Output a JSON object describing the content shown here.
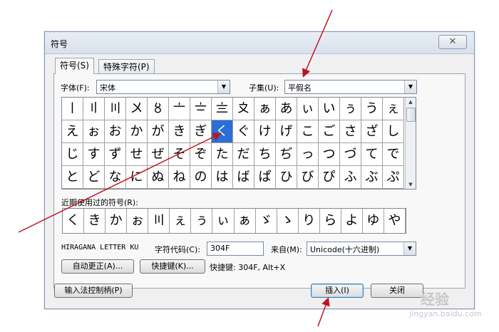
{
  "dialog": {
    "title": "符号",
    "close_glyph": "✕",
    "tabs": [
      {
        "label": "符号(S)",
        "active": true
      },
      {
        "label": "特殊字符(P)",
        "active": false
      }
    ],
    "font_label": "字体(F):",
    "font_value": "宋体",
    "subset_label": "子集(U):",
    "subset_value": "平假名",
    "grid_rows": [
      [
        "〡",
        "〢",
        "〣",
        "〤",
        "〥",
        "〦",
        "〧",
        "〨",
        "〩",
        "ぁ",
        "あ",
        "ぃ",
        "い",
        "ぅ",
        "う",
        "ぇ"
      ],
      [
        "え",
        "ぉ",
        "お",
        "か",
        "が",
        "き",
        "ぎ",
        "く",
        "ぐ",
        "け",
        "げ",
        "こ",
        "ご",
        "さ",
        "ざ",
        "し"
      ],
      [
        "じ",
        "す",
        "ず",
        "せ",
        "ぜ",
        "そ",
        "ぞ",
        "た",
        "だ",
        "ち",
        "ぢ",
        "っ",
        "つ",
        "づ",
        "て",
        "で"
      ],
      [
        "と",
        "ど",
        "な",
        "に",
        "ぬ",
        "ね",
        "の",
        "は",
        "ば",
        "ぱ",
        "ひ",
        "び",
        "ぴ",
        "ふ",
        "ぶ",
        "ぷ"
      ]
    ],
    "selected_char": "く",
    "recent_label": "近期使用过的符号(R):",
    "recent": [
      "く",
      "き",
      "か",
      "ぉ",
      "〣",
      "ぇ",
      "ぅ",
      "ぃ",
      "ぁ",
      "ゞ",
      "ゝ",
      "り",
      "ら",
      "よ",
      "ゆ",
      "や"
    ],
    "char_name": "HIRAGANA LETTER KU",
    "char_code_label": "字符代码(C):",
    "char_code_value": "304F",
    "from_label": "来自(M):",
    "from_value": "Unicode(十六进制)",
    "autocorrect_btn": "自动更正(A)...",
    "shortcut_btn": "快捷键(K)...",
    "shortcut_text": "快捷键: 304F, Alt+X",
    "ime_btn": "输入法控制柄(P)",
    "insert_btn": "插入(I)",
    "close_btn": "关闭"
  },
  "watermark": {
    "main": "经验",
    "sub": "jingyan.baidu.com"
  },
  "colors": {
    "selection": "#2a6fd6",
    "annotation_arrow": "#c0141e"
  }
}
